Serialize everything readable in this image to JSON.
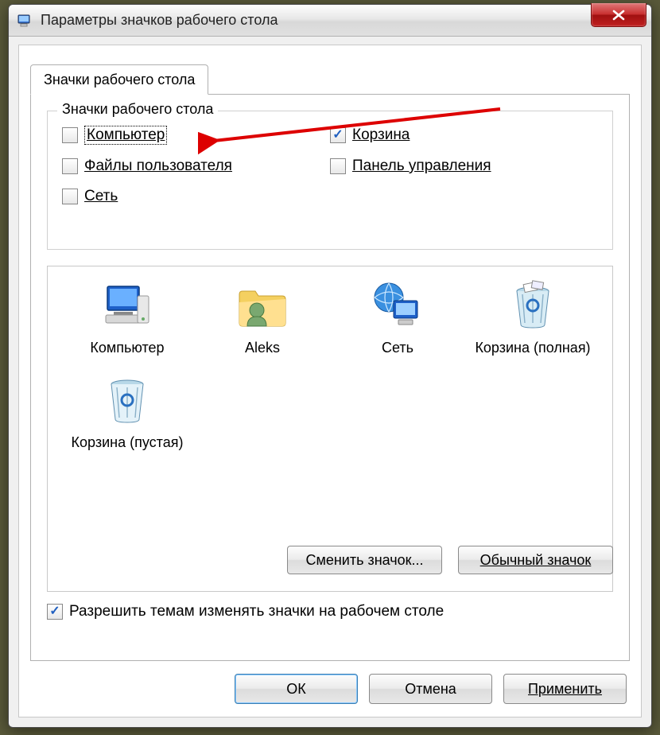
{
  "window": {
    "title": "Параметры значков рабочего стола"
  },
  "tab": {
    "label": "Значки рабочего стола"
  },
  "group": {
    "legend": "Значки рабочего стола",
    "items": {
      "computer": {
        "label": "Компьютер",
        "checked": false,
        "focused": true
      },
      "recycle": {
        "label": "Корзина",
        "checked": true
      },
      "userfiles": {
        "label": "Файлы пользователя",
        "checked": false
      },
      "cpanel": {
        "label": "Панель управления",
        "checked": false
      },
      "network": {
        "label": "Сеть",
        "checked": false
      }
    }
  },
  "icons": {
    "computer": {
      "label": "Компьютер"
    },
    "user": {
      "label": "Aleks"
    },
    "network": {
      "label": "Сеть"
    },
    "recycle_full": {
      "label": "Корзина (полная)"
    },
    "recycle_empty": {
      "label": "Корзина (пустая)"
    }
  },
  "buttons": {
    "change_icon": "Сменить значок...",
    "default_icon": "Обычный значок",
    "ok": "ОК",
    "cancel": "Отмена",
    "apply": "Применить"
  },
  "allow_themes": {
    "label": "Разрешить темам изменять значки на рабочем столе",
    "checked": true
  }
}
